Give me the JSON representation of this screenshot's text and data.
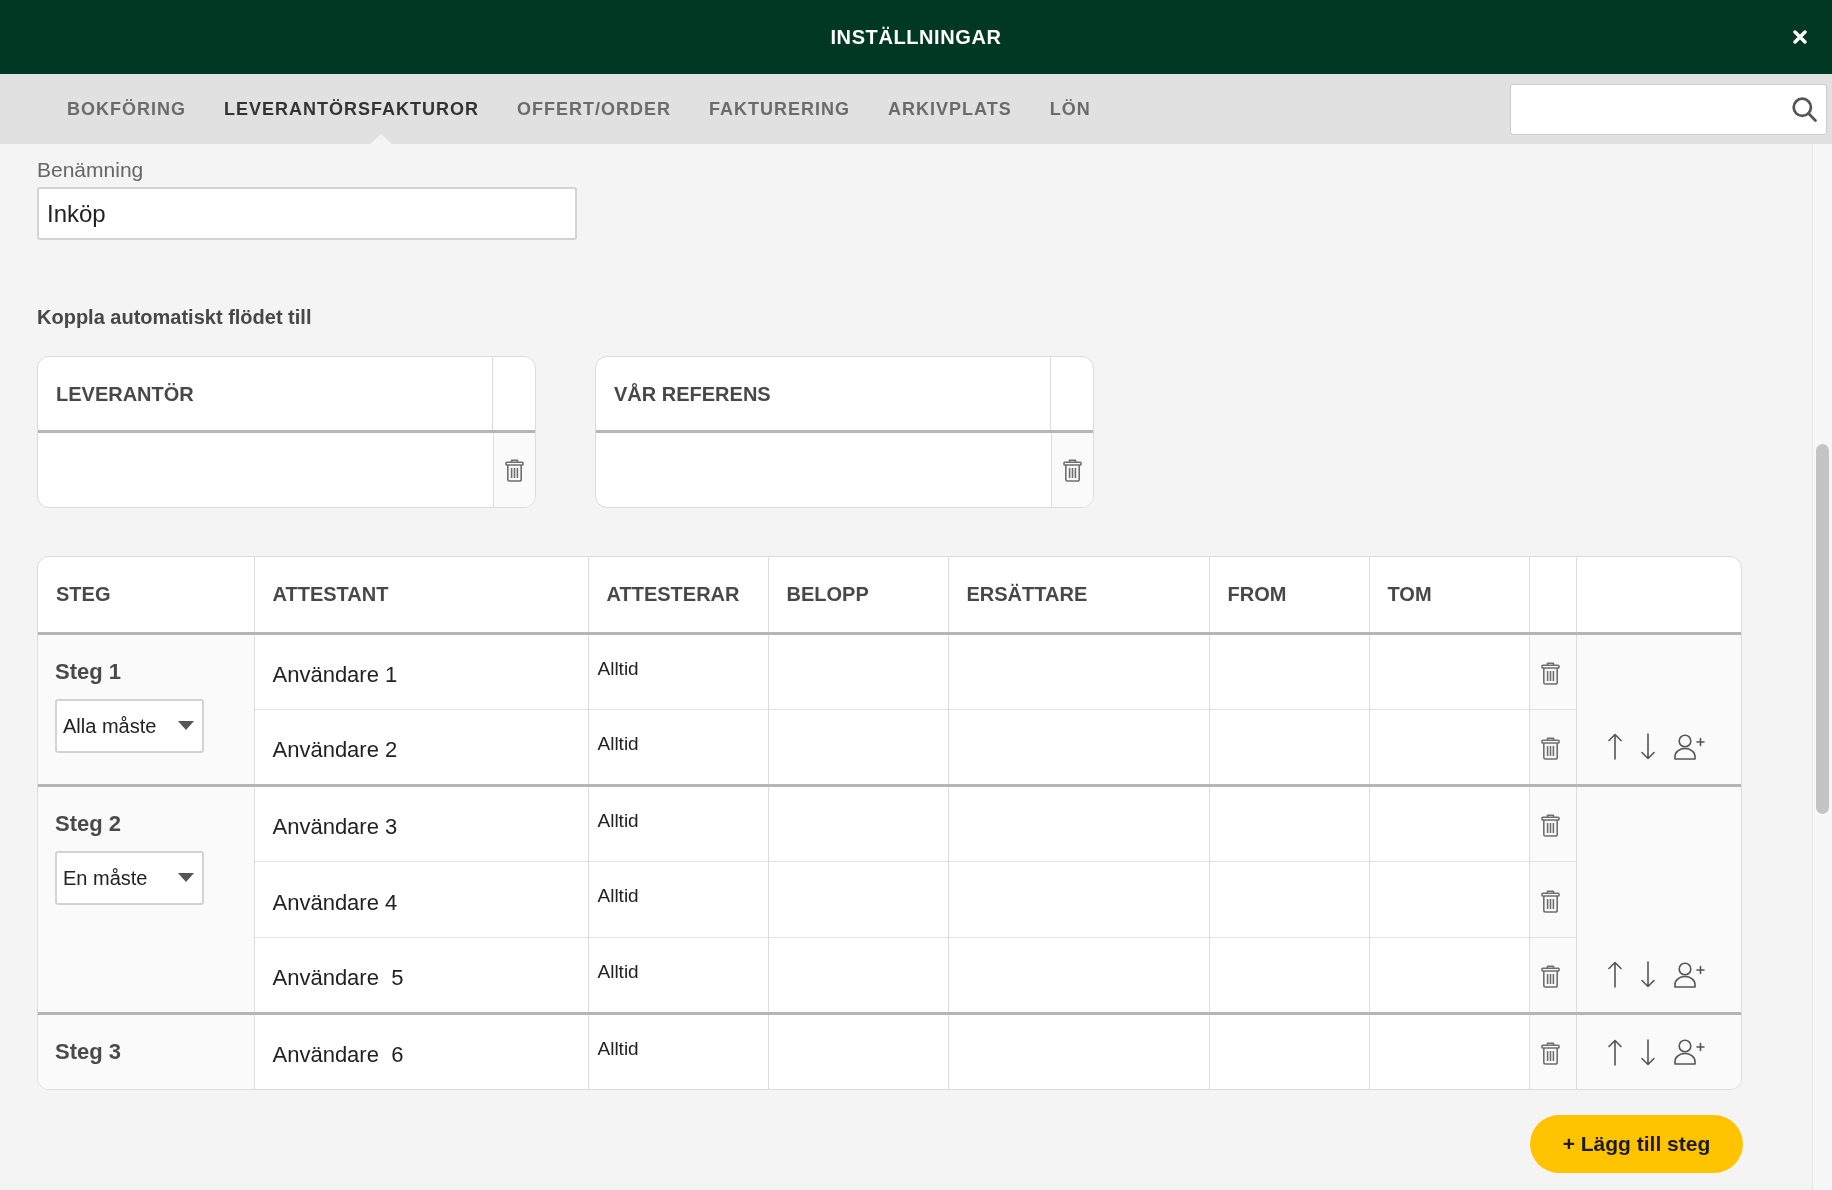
{
  "window": {
    "title": "INSTÄLLNINGAR"
  },
  "tabs": [
    {
      "label": "BOKFÖRING",
      "selected": false
    },
    {
      "label": "LEVERANTÖRSFAKTUROR",
      "selected": true
    },
    {
      "label": "OFFERT/ORDER",
      "selected": false
    },
    {
      "label": "FAKTURERING",
      "selected": false
    },
    {
      "label": "ARKIVPLATS",
      "selected": false
    },
    {
      "label": "LÖN",
      "selected": false
    }
  ],
  "name_field": {
    "label": "Benämning",
    "value": "Inköp"
  },
  "auto_link": {
    "title": "Koppla automatiskt flödet till",
    "tables": [
      {
        "header": "LEVERANTÖR"
      },
      {
        "header": "VÅR REFERENS"
      }
    ]
  },
  "steps_table": {
    "columns": [
      "STEG",
      "ATTESTANT",
      "ATTESTERAR",
      "BELOPP",
      "ERSÄTTARE",
      "FROM",
      "TOM"
    ],
    "steps": [
      {
        "label": "Steg 1",
        "mode": "Alla måste",
        "rows": [
          {
            "attestant": "Användare 1",
            "attesterar": "Alltid"
          },
          {
            "attestant": "Användare 2",
            "attesterar": "Alltid"
          }
        ]
      },
      {
        "label": "Steg 2",
        "mode": "En måste",
        "rows": [
          {
            "attestant": "Användare 3",
            "attesterar": "Alltid"
          },
          {
            "attestant": "Användare 4",
            "attesterar": "Alltid"
          },
          {
            "attestant": "Användare  5",
            "attesterar": "Alltid"
          }
        ]
      },
      {
        "label": "Steg 3",
        "rows": [
          {
            "attestant": "Användare  6",
            "attesterar": "Alltid"
          }
        ]
      }
    ]
  },
  "add_button": {
    "label": "+ Lägg till steg"
  }
}
